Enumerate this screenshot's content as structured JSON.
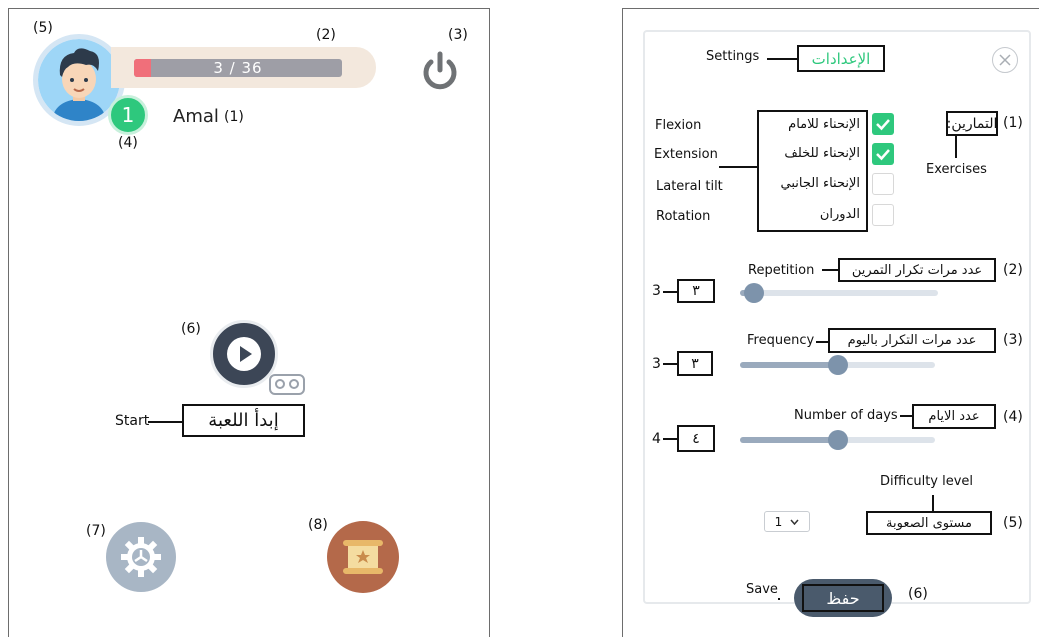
{
  "left": {
    "annotations": {
      "a1": "(1)",
      "a2": "(2)",
      "a3": "(3)",
      "a4": "(4)",
      "a5": "(5)",
      "a6": "(6)",
      "a7": "(7)",
      "a8": "(8)"
    },
    "player_name": "Amal",
    "progress": {
      "text": "3 / 36",
      "current": 3,
      "total": 36
    },
    "level": "1",
    "start_en": "Start",
    "start_ar": "إبدأ اللعبة",
    "icons": {
      "avatar": "boy-avatar-icon",
      "power": "power-icon",
      "play": "play-icon",
      "vr": "vr-headset-icon",
      "settings": "gear-icon",
      "scroll": "scroll-map-icon"
    },
    "colors": {
      "level_badge": "#2ec87d",
      "progress_fill": "#f06f7a",
      "play": "#3c4656",
      "gear": "#a8b6c5",
      "scroll_bg": "#b4694a"
    }
  },
  "right": {
    "settings_en": "Settings",
    "settings_ar": "الإعدادات",
    "exercises": {
      "ann": "(1)",
      "ar": "التمارين:",
      "en": "Exercises",
      "items": [
        {
          "en": "Flexion",
          "ar": "الإنحناء للامام",
          "checked": true
        },
        {
          "en": "Extension",
          "ar": "الإنحناء للخلف",
          "checked": true
        },
        {
          "en": "Lateral tilt",
          "ar": "الإنحناء الجانبي",
          "checked": false
        },
        {
          "en": "Rotation",
          "ar": "الدوران",
          "checked": false
        }
      ]
    },
    "repetition": {
      "ann": "(2)",
      "en": "Repetition",
      "ar": "عدد مرات تكرار التمرين",
      "value_ar": "٣",
      "value": "3",
      "level": 0.07
    },
    "frequency": {
      "ann": "(3)",
      "en": "Frequency",
      "ar": "عدد مرات التكرار باليوم",
      "value_ar": "٣",
      "value": "3",
      "level": 0.5
    },
    "days": {
      "ann": "(4)",
      "en": "Number of days",
      "ar": "عدد الايام",
      "value_ar": "٤",
      "value": "4",
      "level": 0.5
    },
    "difficulty": {
      "ann": "(5)",
      "en": "Difficulty level",
      "ar": "مستوى الصعوبة",
      "selected": "1"
    },
    "save": {
      "ann": "(6)",
      "en": "Save",
      "ar": "حفظ"
    },
    "colors": {
      "accent_green": "#2ec87d",
      "slider": "#7d93ab",
      "save_button": "#4a5a6c"
    }
  }
}
